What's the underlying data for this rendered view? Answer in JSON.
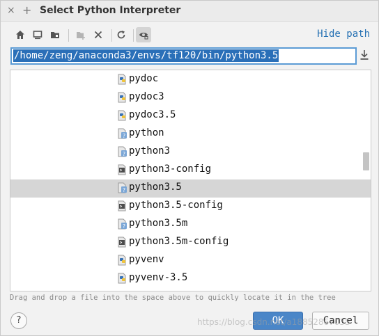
{
  "window": {
    "title": "Select Python Interpreter",
    "close_glyph": "×",
    "maximize_glyph": "+"
  },
  "toolbar": {
    "buttons": [
      "home-icon",
      "desktop-icon",
      "project-folder-icon",
      "new-folder-icon",
      "delete-icon",
      "refresh-icon",
      "show-hidden-icon"
    ],
    "hide_path_label": "Hide path"
  },
  "path": {
    "value": "/home/zeng/anaconda3/envs/tf120/bin/python3.5"
  },
  "tree": {
    "items": [
      {
        "label": "pydoc",
        "icon": "python-file-icon",
        "selected": false
      },
      {
        "label": "pydoc3",
        "icon": "python-file-icon",
        "selected": false
      },
      {
        "label": "pydoc3.5",
        "icon": "python-file-icon",
        "selected": false
      },
      {
        "label": "python",
        "icon": "unknown-file-icon",
        "selected": false
      },
      {
        "label": "python3",
        "icon": "unknown-file-icon",
        "selected": false
      },
      {
        "label": "python3-config",
        "icon": "script-file-icon",
        "selected": false
      },
      {
        "label": "python3.5",
        "icon": "unknown-file-icon",
        "selected": true
      },
      {
        "label": "python3.5-config",
        "icon": "script-file-icon",
        "selected": false
      },
      {
        "label": "python3.5m",
        "icon": "unknown-file-icon",
        "selected": false
      },
      {
        "label": "python3.5m-config",
        "icon": "script-file-icon",
        "selected": false
      },
      {
        "label": "pyvenv",
        "icon": "python-file-icon",
        "selected": false
      },
      {
        "label": "pyvenv-3.5",
        "icon": "python-file-icon",
        "selected": false
      }
    ]
  },
  "hint": "Drag and drop a file into the space above to quickly locate it in the tree",
  "footer": {
    "help_label": "?",
    "ok_label": "OK",
    "cancel_label": "Cancel",
    "watermark": "https://blog.csdn.net/a18852867035"
  },
  "colors": {
    "accent": "#4a86c8",
    "selection": "#2a6fb8",
    "link": "#2470b3",
    "row_selected": "#d6d6d6"
  }
}
